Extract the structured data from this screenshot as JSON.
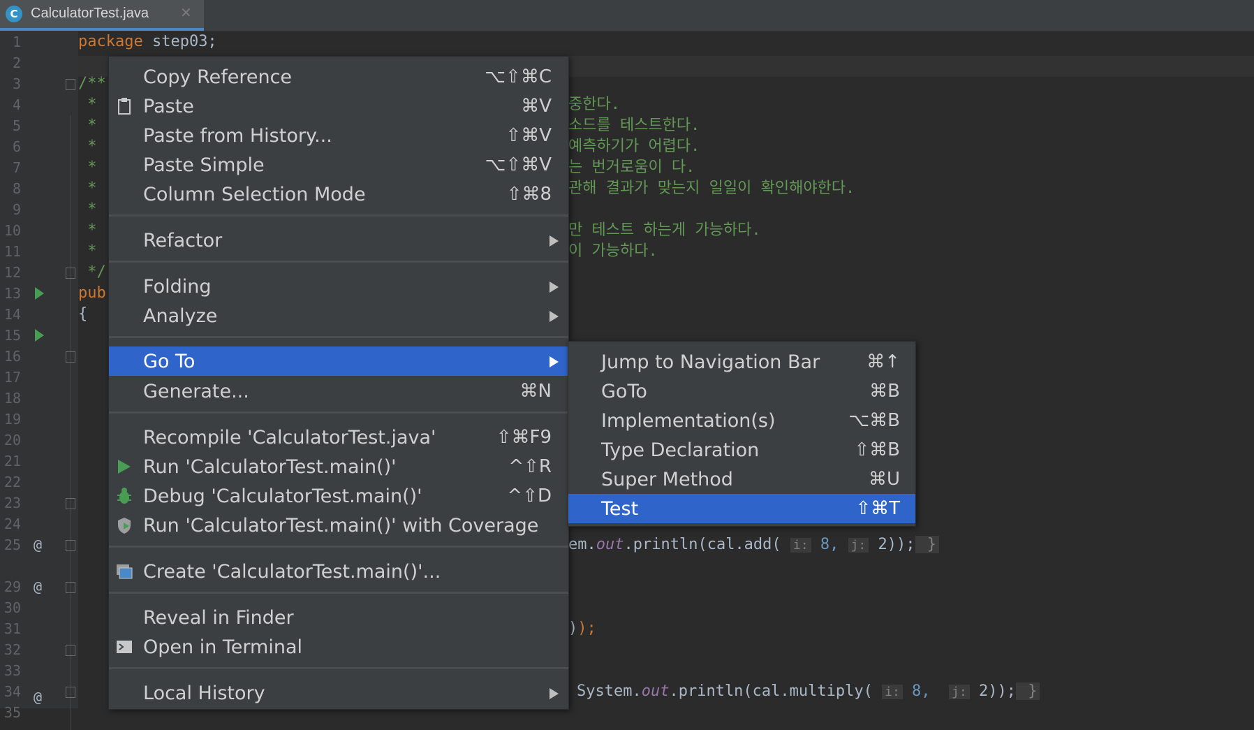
{
  "tab": {
    "title": "CalculatorTest.java",
    "icon": "java-class-icon",
    "icon_letter": "C"
  },
  "gutter": {
    "line_numbers": [
      "1",
      "2",
      "3",
      "4",
      "5",
      "6",
      "7",
      "8",
      "9",
      "10",
      "11",
      "12",
      "13",
      "14",
      "15",
      "16",
      "17",
      "18",
      "19",
      "20",
      "21",
      "22",
      "23",
      "24",
      "25",
      "29",
      "30",
      "31",
      "32",
      "33",
      "34",
      "35"
    ],
    "at": "@"
  },
  "code": {
    "l1_kw": "package",
    "l1_rest": " step03;",
    "l3": "/**",
    "l4_star": " *",
    "l4_tail": "중한다.",
    "l5_star": " *",
    "l5_tail": "소드를 테스트한다.",
    "l6_star": " *",
    "l6_tail": "예측하기가 어렵다.",
    "l7_star": " *",
    "l7_tail": "는 번거로움이 다.",
    "l8_star": " *",
    "l8_tail": "관해 결과가 맞는지 일일이 확인해야한다.",
    "l9_star": " *",
    "l10_star": " *",
    "l10_tail": "만 테스트 하는게 가능하다.",
    "l11_star": " *",
    "l11_tail": "이 가능하다.",
    "l12": " */",
    "l13_kw": "pub",
    "l14": "{",
    "l25_a": "em.",
    "l25_field": "out",
    "l25_b": ".println(cal.add( ",
    "l25_hi": "i:",
    "l25_c": " 8, ",
    "l25_hj": "j:",
    "l25_d": " 2));",
    "l25_e": " }",
    "l32": ")",
    "l32_semi": ");",
    "l35_a": "System.",
    "l35_field": "out",
    "l35_b": ".println(cal.multiply( ",
    "l35_hi": "i:",
    "l35_c": " 8,  ",
    "l35_hj": "j:",
    "l35_d": " 2));",
    "l35_e": " }"
  },
  "context_menu": {
    "copy_reference": {
      "label": "Copy Reference",
      "shortcut": "⌥⇧⌘C"
    },
    "paste": {
      "label": "Paste",
      "shortcut": "⌘V",
      "icon": "clipboard-icon"
    },
    "paste_history": {
      "label": "Paste from History...",
      "shortcut": "⇧⌘V"
    },
    "paste_simple": {
      "label": "Paste Simple",
      "shortcut": "⌥⇧⌘V"
    },
    "column_selection": {
      "label": "Column Selection Mode",
      "shortcut": "⇧⌘8"
    },
    "refactor": {
      "label": "Refactor"
    },
    "folding": {
      "label": "Folding"
    },
    "analyze": {
      "label": "Analyze"
    },
    "goto": {
      "label": "Go To"
    },
    "generate": {
      "label": "Generate...",
      "shortcut": "⌘N"
    },
    "recompile": {
      "label": "Recompile 'CalculatorTest.java'",
      "shortcut": "⇧⌘F9"
    },
    "run": {
      "label": "Run 'CalculatorTest.main()'",
      "shortcut": "^⇧R",
      "icon": "run-icon"
    },
    "debug": {
      "label": "Debug 'CalculatorTest.main()'",
      "shortcut": "^⇧D",
      "icon": "debug-bug-icon"
    },
    "coverage": {
      "label": "Run 'CalculatorTest.main()' with Coverage",
      "icon": "coverage-shield-icon"
    },
    "create": {
      "label": "Create 'CalculatorTest.main()'...",
      "icon": "run-config-icon"
    },
    "reveal": {
      "label": "Reveal in Finder"
    },
    "terminal": {
      "label": "Open in Terminal",
      "icon": "terminal-icon"
    },
    "local_history": {
      "label": "Local History"
    }
  },
  "goto_submenu": {
    "jump_nav": {
      "label": "Jump to Navigation Bar",
      "shortcut": "⌘↑"
    },
    "goto": {
      "label": "GoTo",
      "shortcut": "⌘B"
    },
    "implementations": {
      "label": "Implementation(s)",
      "shortcut": "⌥⌘B"
    },
    "type_decl": {
      "label": "Type Declaration",
      "shortcut": "⇧⌘B"
    },
    "super_method": {
      "label": "Super Method",
      "shortcut": "⌘U"
    },
    "test": {
      "label": "Test",
      "shortcut": "⇧⌘T"
    }
  },
  "colors": {
    "selection": "#2f65ca",
    "menu_bg": "#3c3f41",
    "editor_bg": "#2b2b2b",
    "keyword": "#cc7832",
    "comment": "#629755"
  }
}
